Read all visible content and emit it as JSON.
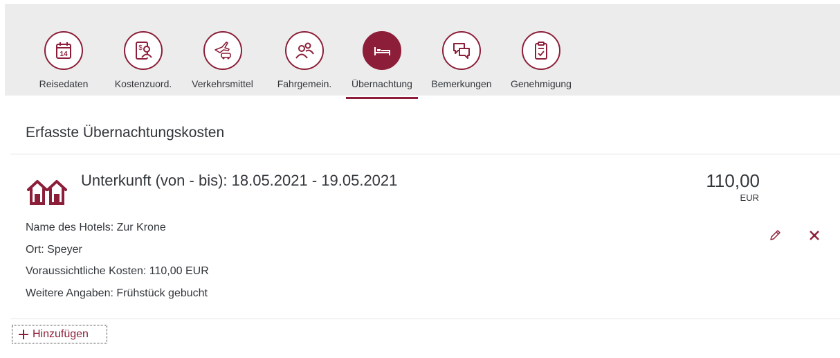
{
  "steps": [
    {
      "label": "Reisedaten",
      "icon": "calendar-14-icon",
      "active": false
    },
    {
      "label": "Kostenzuord.",
      "icon": "cost-assignment-icon",
      "active": false
    },
    {
      "label": "Verkehrsmittel",
      "icon": "transport-plane-car-icon",
      "active": false
    },
    {
      "label": "Fahrgemein.",
      "icon": "carpool-people-icon",
      "active": false
    },
    {
      "label": "Übernachtung",
      "icon": "bed-icon",
      "active": true
    },
    {
      "label": "Bemerkungen",
      "icon": "comments-icon",
      "active": false
    },
    {
      "label": "Genehmigung",
      "icon": "approval-clipboard-icon",
      "active": false
    }
  ],
  "calendar_day": "14",
  "section_title": "Erfasste Übernachtungskosten",
  "item": {
    "title": "Unterkunft (von - bis): 18.05.2021 - 19.05.2021",
    "amount": "110,00",
    "currency": "EUR",
    "details": [
      "Name des Hotels: Zur Krone",
      "Ort: Speyer",
      "Voraussichtliche Kosten: 110,00 EUR",
      "Weitere Angaben: Frühstück gebucht"
    ]
  },
  "add_label": "Hinzufügen",
  "colors": {
    "accent": "#8c1e39",
    "topbar": "#ececec",
    "text": "#32363a"
  }
}
